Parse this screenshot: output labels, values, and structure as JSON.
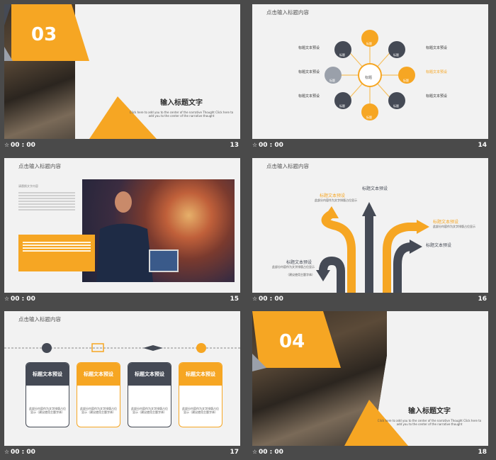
{
  "colors": {
    "orange": "#f6a623",
    "dark": "#454a55",
    "bg": "#f2f2f2",
    "frame": "#4a4a4a"
  },
  "slides": [
    {
      "number": "13",
      "time": "00 : 00",
      "badge": "03",
      "title": "输入标题文字",
      "body": "Click here to add  you to the  center of the  narrative Thought   Click here to add   you to the center of the narrative thought"
    },
    {
      "number": "14",
      "time": "00 : 00",
      "heading": "点击输入标题内容",
      "center_label": "标题",
      "nodes": [
        "标题",
        "标题",
        "标题",
        "标题",
        "标题",
        "标题",
        "标题",
        "标题"
      ],
      "left_labels": [
        "标题文本预设",
        "标题文本预设",
        "标题文本预设"
      ],
      "right_labels": [
        "标题文本预设",
        "标题文本预设",
        "标题文本预设"
      ]
    },
    {
      "number": "15",
      "time": "00 : 00",
      "heading": "点击输入标题内容",
      "caption": "请替换文字内容"
    },
    {
      "number": "16",
      "time": "00 : 00",
      "heading": "点击输入标题内容",
      "labels": [
        "标题文本预设",
        "标题文本预设",
        "标题文本预设",
        "标题文本预设",
        "标题文本预设"
      ],
      "desc": "此部分内容作为文字排版占位显示",
      "note": "（建议使用主题字体）"
    },
    {
      "number": "17",
      "time": "00 : 00",
      "heading": "点击输入标题内容",
      "cards": [
        {
          "title": "标题文本预设",
          "text": "此部分内容作为文字排版占位显示（建议使用主题字体）",
          "style": "dark"
        },
        {
          "title": "标题文本预设",
          "text": "此部分内容作为文字排版占位显示（建议使用主题字体）",
          "style": "orange"
        },
        {
          "title": "标题文本预设",
          "text": "此部分内容作为文字排版占位显示（建议使用主题字体）",
          "style": "dark"
        },
        {
          "title": "标题文本预设",
          "text": "此部分内容作为文字排版占位显示（建议使用主题字体）",
          "style": "orange"
        }
      ]
    },
    {
      "number": "18",
      "time": "00 : 00",
      "badge": "04",
      "title": "输入标题文字",
      "body": "Click here to add  you to the  center of the  narrative Thought   Click here to add   you to the center of the narrative thought"
    }
  ]
}
